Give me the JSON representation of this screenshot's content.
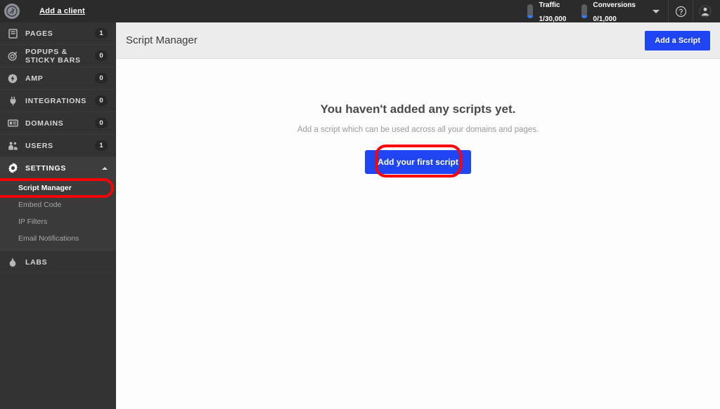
{
  "sidebar": {
    "logo_icon": "brand-logo-icon",
    "add_client_label": "Add a client",
    "items": [
      {
        "label": "PAGES",
        "badge": "1",
        "icon": "page-icon"
      },
      {
        "label": "POPUPS & STICKY BARS",
        "badge": "0",
        "icon": "target-icon"
      },
      {
        "label": "AMP",
        "badge": "0",
        "icon": "bolt-icon"
      },
      {
        "label": "INTEGRATIONS",
        "badge": "0",
        "icon": "plug-icon"
      },
      {
        "label": "DOMAINS",
        "badge": "0",
        "icon": "card-icon"
      },
      {
        "label": "USERS",
        "badge": "1",
        "icon": "users-icon"
      },
      {
        "label": "SETTINGS",
        "badge": "",
        "icon": "gear-icon"
      }
    ],
    "settings_subitems": [
      {
        "label": "Script Manager"
      },
      {
        "label": "Embed Code"
      },
      {
        "label": "IP Filters"
      },
      {
        "label": "Email Notifications"
      }
    ],
    "labs": {
      "label": "LABS",
      "icon": "flask-icon"
    }
  },
  "topbar": {
    "traffic": {
      "label": "Traffic",
      "value": "1/30,000"
    },
    "conversions": {
      "label": "Conversions",
      "value": "0/1,000"
    },
    "dropdown_icon": "chevron-down-icon",
    "help_icon": "help-circle-icon",
    "account_icon": "user-avatar-icon"
  },
  "page": {
    "title": "Script Manager",
    "add_script_label": "Add a Script"
  },
  "empty_state": {
    "title": "You haven't added any scripts yet.",
    "subtitle": "Add a script which can be used across all your domains and pages.",
    "cta_label": "Add your first script"
  },
  "colors": {
    "accent_blue": "#1f45f5",
    "annotation_red": "#fb0007",
    "sidebar_bg": "#333333",
    "topbar_bg": "#2b2b2b",
    "header_bg": "#ececec"
  }
}
